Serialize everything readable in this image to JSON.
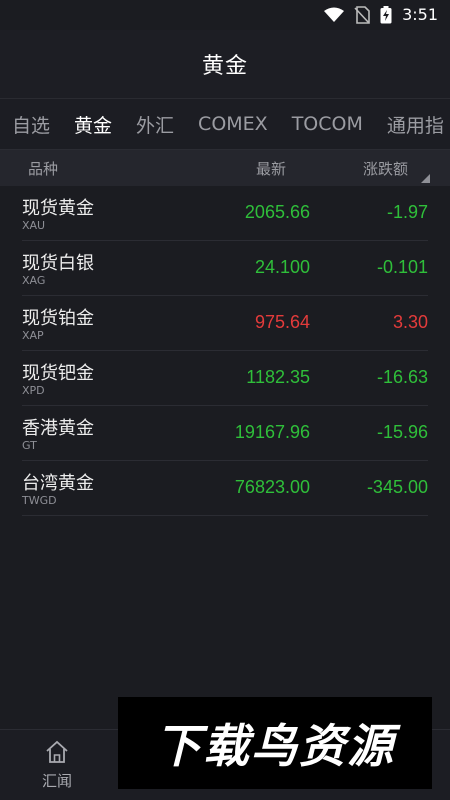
{
  "status_bar": {
    "time": "3:51"
  },
  "header": {
    "title": "黄金"
  },
  "tabs": [
    {
      "label": "自选",
      "active": false
    },
    {
      "label": "黄金",
      "active": true
    },
    {
      "label": "外汇",
      "active": false
    },
    {
      "label": "COMEX",
      "active": false
    },
    {
      "label": "TOCOM",
      "active": false
    },
    {
      "label": "通用指",
      "active": false
    }
  ],
  "columns": {
    "name": "品种",
    "latest": "最新",
    "change": "涨跌额"
  },
  "rows": [
    {
      "name": "现货黄金",
      "code": "XAU",
      "price": "2065.66",
      "change": "-1.97",
      "color": "green"
    },
    {
      "name": "现货白银",
      "code": "XAG",
      "price": "24.100",
      "change": "-0.101",
      "color": "green"
    },
    {
      "name": "现货铂金",
      "code": "XAP",
      "price": "975.64",
      "change": "3.30",
      "color": "red"
    },
    {
      "name": "现货钯金",
      "code": "XPD",
      "price": "1182.35",
      "change": "-16.63",
      "color": "green"
    },
    {
      "name": "香港黄金",
      "code": "GT",
      "price": "19167.96",
      "change": "-15.96",
      "color": "green"
    },
    {
      "name": "台湾黄金",
      "code": "TWGD",
      "price": "76823.00",
      "change": "-345.00",
      "color": "green"
    }
  ],
  "bottom_nav": {
    "item1_label": "汇闻"
  },
  "watermark": {
    "text": "下载鸟资源"
  },
  "colors": {
    "up": "#e33b3b",
    "down": "#2fbf3a",
    "background": "#1b1c21"
  }
}
